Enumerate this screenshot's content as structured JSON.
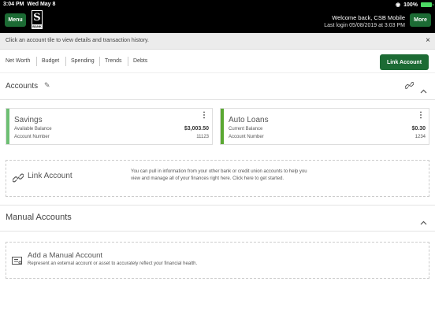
{
  "status_bar": {
    "time": "3:04 PM",
    "date": "Wed May 8",
    "battery": "100%"
  },
  "header": {
    "menu_label": "Menu",
    "more_label": "More",
    "logo_letter": "S",
    "logo_subtext": "BANK",
    "welcome": "Welcome back, CSB Mobile",
    "last_login": "Last login 05/08/2019 at 3:03 PM"
  },
  "banner": {
    "text": "Click an account tile to view details and transaction history.",
    "close": "×"
  },
  "tabs": [
    "Net Worth",
    "Budget",
    "Spending",
    "Trends",
    "Debts"
  ],
  "link_account_button": "Link Account",
  "accounts_section": {
    "title": "Accounts",
    "cards": [
      {
        "name": "Savings",
        "balance_label": "Available Balance",
        "balance": "$3,003.50",
        "number_label": "Account Number",
        "number": "11123",
        "color": "#6dbf73"
      },
      {
        "name": "Auto Loans",
        "balance_label": "Current Balance",
        "balance": "$0.30",
        "number_label": "Account Number",
        "number": "1234",
        "color": "#5aa832"
      }
    ]
  },
  "link_box": {
    "title": "Link Account",
    "desc_line1": "You can pull in information from your other bank or credit union accounts to help you",
    "desc_line2": "view and manage all of your finances right here. Click here to get started."
  },
  "manual_section": {
    "title": "Manual Accounts"
  },
  "manual_box": {
    "title": "Add a Manual Account",
    "desc": "Represent an external account or asset to accurately reflect your financial health."
  }
}
